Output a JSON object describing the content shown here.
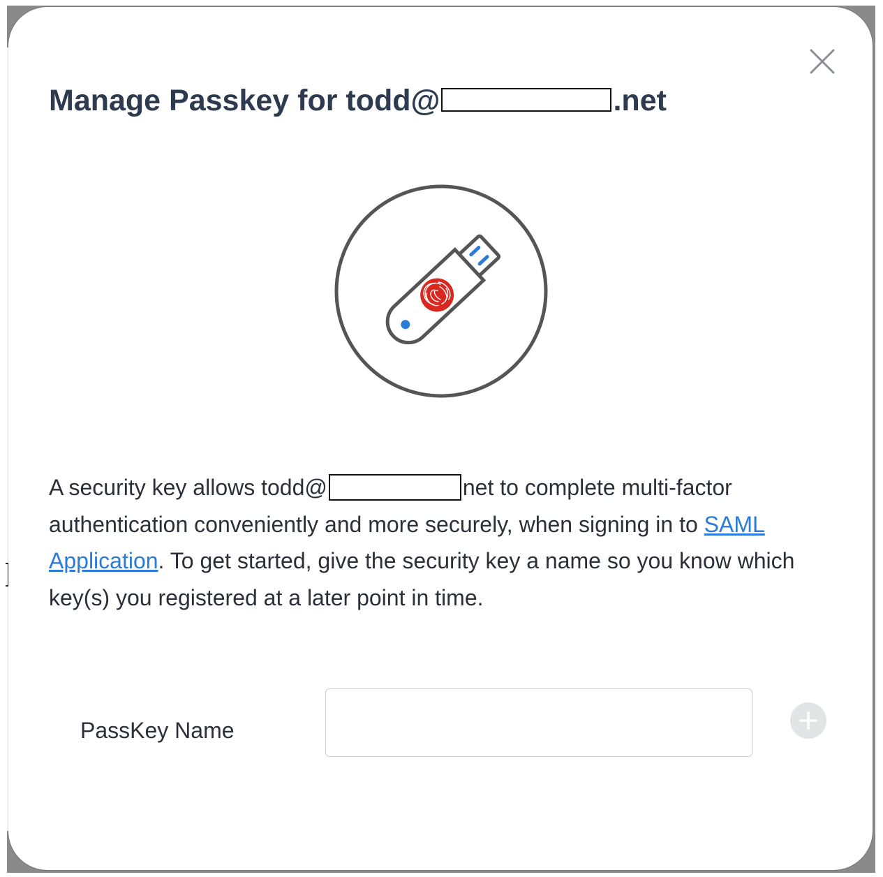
{
  "dialog": {
    "title_prefix": "Manage Passkey for todd@",
    "title_suffix": ".net",
    "close_icon": "close-icon",
    "illustration_icon": "security-key-fingerprint-icon"
  },
  "description": {
    "part1": "A security key allows todd@",
    "part2": "net to complete multi-factor authentication conveniently and more securely, when signing in to ",
    "link_text": "SAML Application",
    "part3": ". To get started, give the security key a name so you know which key(s) you registered at a later point in time."
  },
  "form": {
    "label": "PassKey Name",
    "input_value": "",
    "input_placeholder": "",
    "add_icon": "plus-circle-icon"
  },
  "colors": {
    "title": "#2d3a4f",
    "link": "#2b7bd9",
    "fingerprint_red": "#d8281f",
    "key_blue": "#2b7bd9",
    "outline_gray": "#555555",
    "add_button_bg": "#e3e4e6"
  }
}
